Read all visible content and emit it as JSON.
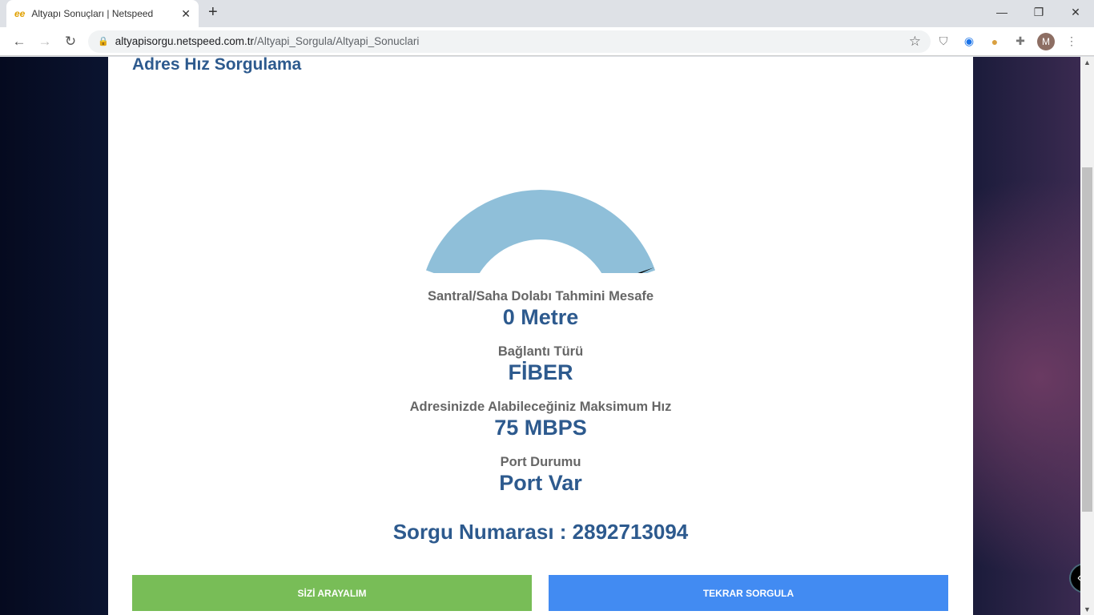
{
  "browser": {
    "tab_title": "Altyapı Sonuçları | Netspeed",
    "favicon": "ee",
    "url_host": "altyapisorgu.netspeed.com.tr",
    "url_path": "/Altyapi_Sorgula/Altyapi_Sonuclari",
    "avatar": "M"
  },
  "page": {
    "title": "Adres Hız Sorgulama",
    "gauge": {
      "value_fraction": 0.99,
      "color": "#8fbfd9"
    },
    "fields": [
      {
        "label": "Santral/Saha Dolabı Tahmini Mesafe",
        "value": "0 Metre"
      },
      {
        "label": "Bağlantı Türü",
        "value": "FİBER"
      },
      {
        "label": "Adresinizde Alabileceğiniz Maksimum Hız",
        "value": "75 MBPS"
      },
      {
        "label": "Port Durumu",
        "value": "Port Var"
      }
    ],
    "query_number": "Sorgu Numarası : 2892713094",
    "call_button": "SİZİ ARAYALIM",
    "requery_button": "TEKRAR SORGULA",
    "colors": {
      "green": "#78bd57",
      "blue": "#428bf2"
    }
  }
}
